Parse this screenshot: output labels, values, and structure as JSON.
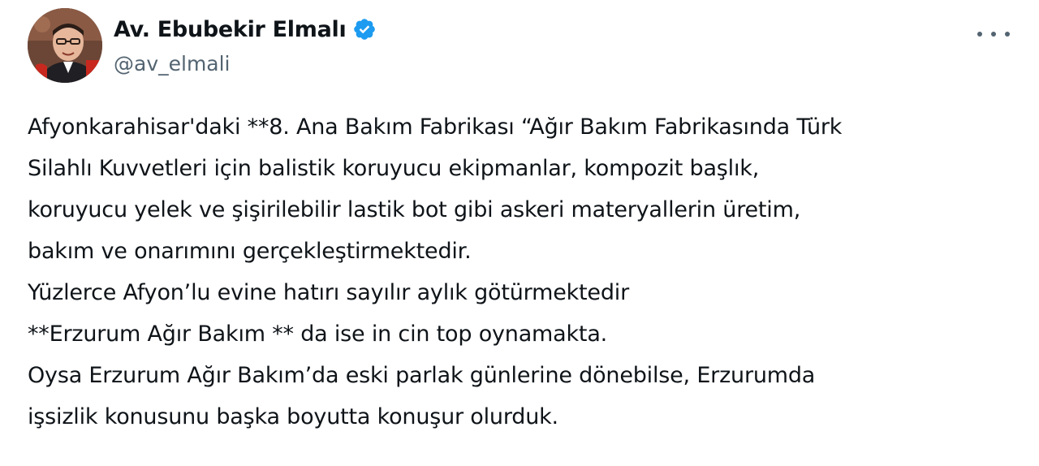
{
  "author": {
    "display_name": "Av. Ebubekir Elmalı",
    "username": "@av_elmali",
    "verified_icon": "verified-badge-icon",
    "avatar_icon": "profile-photo"
  },
  "menu": {
    "icon": "more-horizontal-icon"
  },
  "tweet": {
    "lines": [
      "Afyonkarahisar'daki **8. Ana Bakım Fabrikası “Ağır Bakım Fabrikasında Türk",
      "Silahlı Kuvvetleri için balistik koruyucu ekipmanlar, kompozit başlık,",
      "koruyucu yelek ve şişirilebilir lastik bot gibi askeri materyallerin üretim,",
      "bakım ve onarımını gerçekleştirmektedir.",
      "Yüzlerce Afyon’lu evine hatırı sayılır aylık götürmektedir",
      "**Erzurum Ağır Bakım ** da ise in cin top oynamakta.",
      "Oysa Erzurum Ağır Bakım’da eski parlak günlerine dönebilse, Erzurumda",
      "işsizlik konusunu başka boyutta konuşur olurduk."
    ]
  },
  "colors": {
    "text": "#0f1419",
    "secondary": "#536471",
    "verified": "#1d9bf0",
    "background": "#ffffff"
  }
}
